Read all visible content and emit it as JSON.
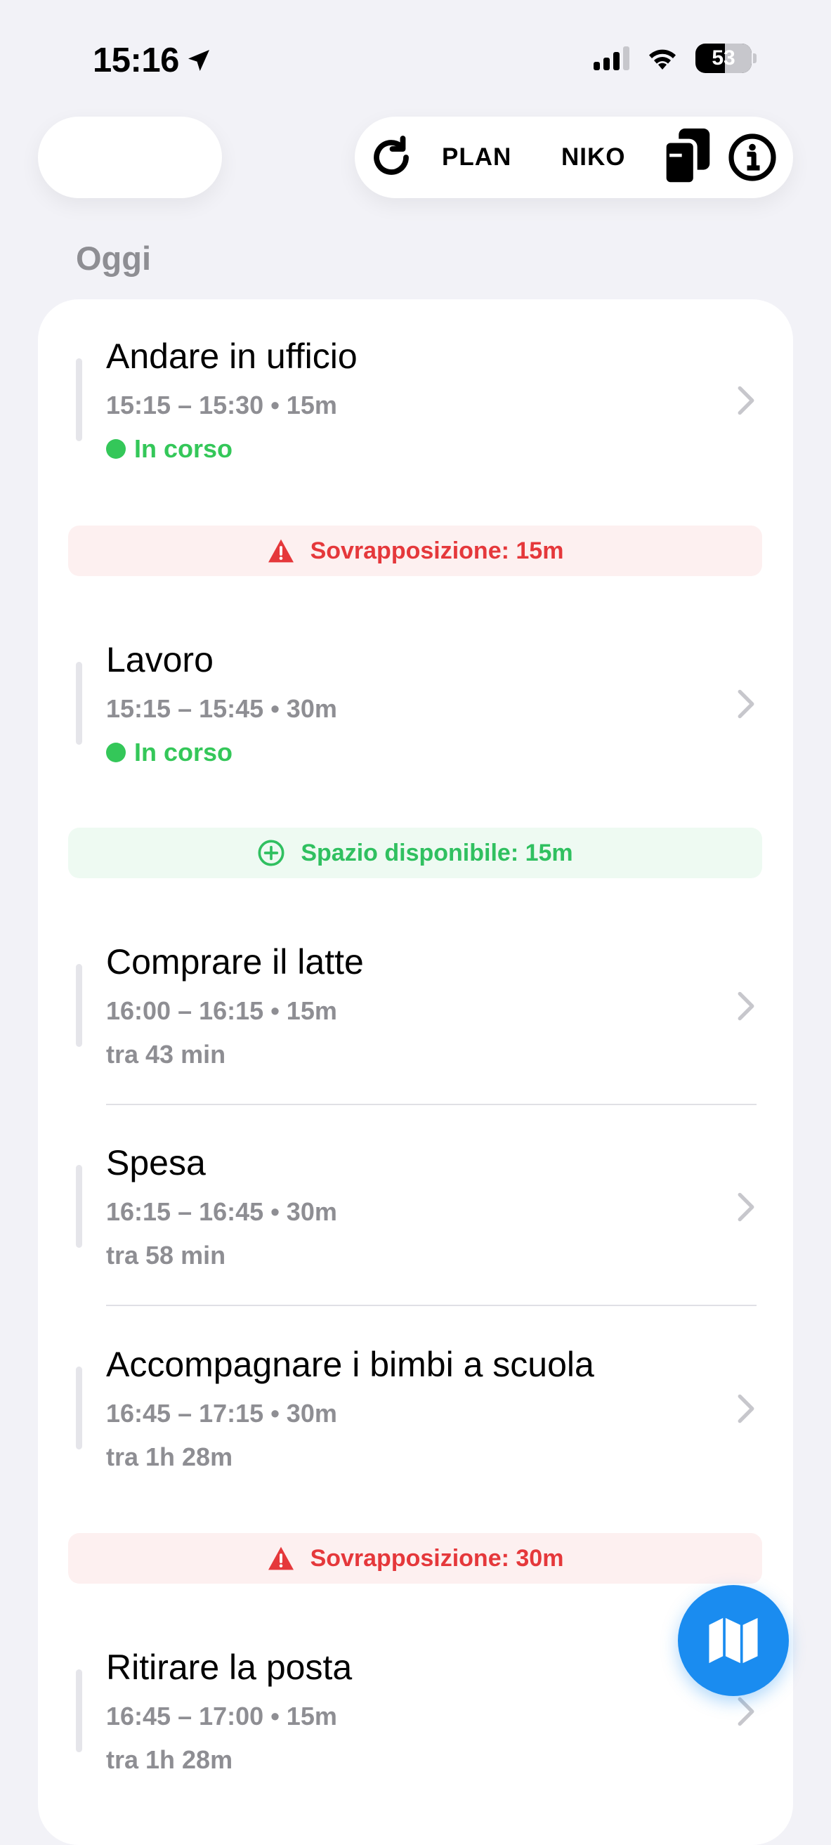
{
  "status_bar": {
    "time": "15:16",
    "battery": "53"
  },
  "toolbar": {
    "plan_label": "PLAN",
    "niko_label": "NIKO"
  },
  "section": {
    "title": "Oggi"
  },
  "tasks": [
    {
      "title": "Andare in ufficio",
      "time": "15:15 – 15:30",
      "duration": "15m",
      "status": "In corso"
    },
    {
      "title": "Lavoro",
      "time": "15:15 – 15:45",
      "duration": "30m",
      "status": "In corso"
    },
    {
      "title": "Comprare il latte",
      "time": "16:00 – 16:15",
      "duration": "15m",
      "status": "tra 43 min"
    },
    {
      "title": "Spesa",
      "time": "16:15 – 16:45",
      "duration": "30m",
      "status": "tra 58 min"
    },
    {
      "title": "Accompagnare i bimbi a scuola",
      "time": "16:45 – 17:15",
      "duration": "30m",
      "status": "tra 1h 28m"
    },
    {
      "title": "Ritirare la posta",
      "time": "16:45 – 17:00",
      "duration": "15m",
      "status": "tra 1h 28m"
    }
  ],
  "banners": {
    "overlap_1": "Sovrapposizione: 15m",
    "free_1": "Spazio disponibile: 15m",
    "overlap_2": "Sovrapposizione: 30m"
  },
  "colors": {
    "accent": "#1a8cf0",
    "in_progress": "#34c759",
    "overlap": "#e5383b",
    "free": "#30c060"
  },
  "fab": {
    "icon": "map-icon"
  }
}
